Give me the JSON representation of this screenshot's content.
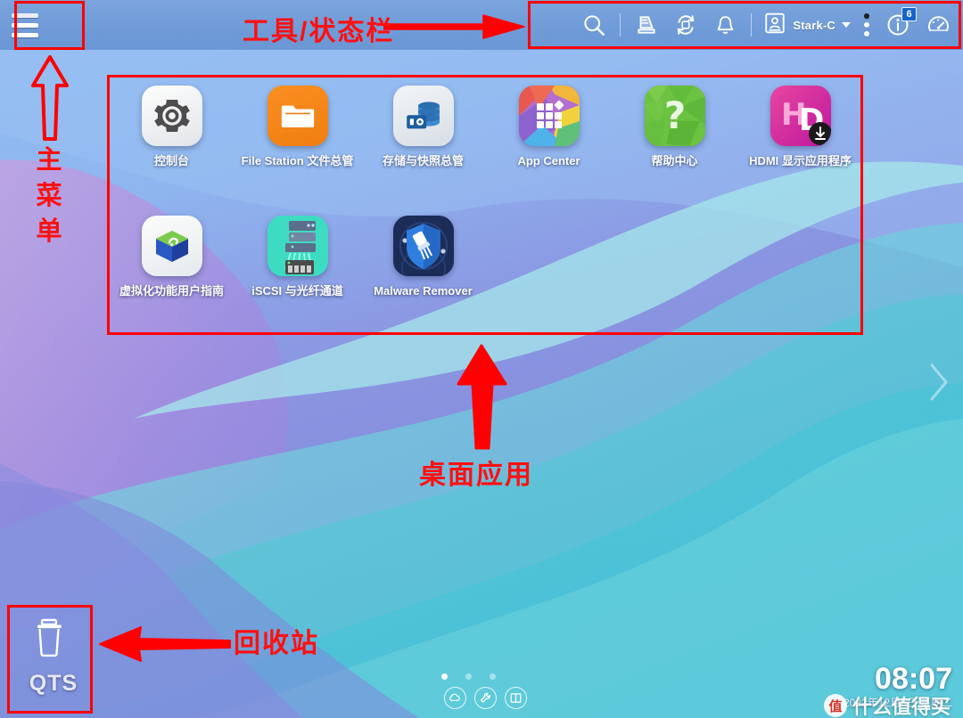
{
  "meta": {
    "os_name": "QTS",
    "screen": "1080x806"
  },
  "toolbar": {
    "menu_button": "main-menu",
    "icons": [
      {
        "name": "search-icon",
        "label": "搜索"
      },
      {
        "name": "printer-icon",
        "label": "打印"
      },
      {
        "name": "sync-icon",
        "label": "同步"
      },
      {
        "name": "bell-icon",
        "label": "通知"
      }
    ],
    "user": {
      "name": "Stark-C",
      "avatar_icon": "user-avatar-icon",
      "caret_icon": "chevron-down-icon"
    },
    "more_icon": "three-dots-icon",
    "info_icon": "info-icon",
    "info_badge": "6",
    "dashboard_icon": "dashboard-gauge-icon"
  },
  "apps": [
    {
      "label": "控制台",
      "icon": "control-panel-icon",
      "class": "ic-control"
    },
    {
      "label": "File Station 文件总管",
      "icon": "file-station-icon",
      "class": "ic-file"
    },
    {
      "label": "存储与快照总管",
      "icon": "storage-snapshot-icon",
      "class": "ic-storage"
    },
    {
      "label": "App Center",
      "icon": "app-center-icon",
      "class": "ic-appctr"
    },
    {
      "label": "帮助中心",
      "icon": "help-center-icon",
      "class": "ic-help"
    },
    {
      "label": "HDMI 显示应用程序",
      "icon": "hdmi-app-icon",
      "class": "ic-hdmi"
    },
    {
      "label": "虚拟化功能用户指南",
      "icon": "virtualization-guide-icon",
      "class": "ic-vm"
    },
    {
      "label": "iSCSI 与光纤通道",
      "icon": "iscsi-fibre-channel-icon",
      "class": "ic-iscsi"
    },
    {
      "label": "Malware Remover",
      "icon": "malware-remover-icon",
      "class": "ic-malware"
    }
  ],
  "recycle_bin": {
    "icon": "trash-icon",
    "label": "QTS"
  },
  "pager": {
    "pages": 3,
    "active": 1
  },
  "dock": [
    {
      "name": "cloud-link-icon"
    },
    {
      "name": "tools-icon"
    },
    {
      "name": "window-layout-icon"
    }
  ],
  "clock": {
    "time": "08:07",
    "date": "2022年12月6日 星期二"
  },
  "watermark": {
    "logo_glyph": "值",
    "text": "什么值得买"
  },
  "pager_next_icon": "chevron-right-icon",
  "annotations": {
    "toolbar_label": "工具/状态栏",
    "main_menu_label": "主菜单",
    "desktop_apps_label": "桌面应用",
    "recycle_bin_label": "回收站",
    "color": "#ff0000"
  }
}
